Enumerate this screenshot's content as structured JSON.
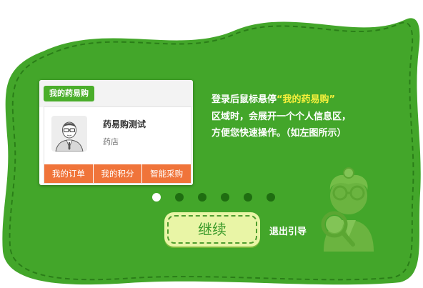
{
  "card": {
    "my_button": "我的药易购",
    "user_name": "药易购测试",
    "store_type": "药店",
    "links": [
      "我的订单",
      "我的积分",
      "智能采购"
    ]
  },
  "guide": {
    "line1_prefix": "登录后鼠标悬停",
    "line1_highlight": "“我的药易购”",
    "line2": "区域时，会展开一个个人信息区，",
    "line3": "方便您快速操作。（如左图所示）"
  },
  "pagination": {
    "total": 6,
    "active": 1
  },
  "buttons": {
    "continue": "继续",
    "exit": "退出引导"
  },
  "colors": {
    "green": "#43a62a",
    "dark_green": "#2a7d18",
    "highlight": "#f6f03c",
    "orange": "#f0743a"
  },
  "icons": [
    "avatar-man-icon",
    "doctor-illustration"
  ]
}
